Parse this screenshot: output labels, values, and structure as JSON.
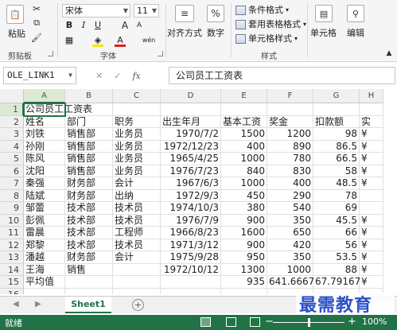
{
  "ribbon": {
    "paste_label": "粘贴",
    "clipboard_label": "剪贴板",
    "font_name": "宋体",
    "font_size": "11",
    "bold": "B",
    "italic": "I",
    "underline": "U",
    "grow_font": "A",
    "shrink_font": "A",
    "font_color_glyph": "A",
    "wen_label": "wén",
    "font_label": "字体",
    "align_label": "对齐方式",
    "number_label": "数字",
    "percent_glyph": "%",
    "cond_format_label": "条件格式",
    "table_format_label": "套用表格格式",
    "cell_style_label": "单元格样式",
    "styles_label": "样式",
    "cells_label": "单元格",
    "edit_label": "编辑"
  },
  "formula_bar": {
    "name_box": "OLE_LINK1",
    "cancel_glyph": "✕",
    "enter_glyph": "✓",
    "fx_glyph": "fx",
    "formula": "公司员工工资表"
  },
  "columns": [
    "A",
    "B",
    "C",
    "D",
    "E",
    "F",
    "G",
    "H"
  ],
  "rows": [
    {
      "n": "1",
      "c": [
        "公司员工工资表",
        "",
        "",
        "",
        "",
        "",
        "",
        ""
      ]
    },
    {
      "n": "2",
      "c": [
        "姓名",
        "部门",
        "职务",
        "出生年月",
        "基本工资",
        "奖金",
        "扣款额",
        "实"
      ]
    },
    {
      "n": "3",
      "c": [
        "刘铁",
        "销售部",
        "业务员",
        "1970/7/2",
        "1500",
        "1200",
        "98",
        "¥"
      ]
    },
    {
      "n": "4",
      "c": [
        "孙刚",
        "销售部",
        "业务员",
        "1972/12/23",
        "400",
        "890",
        "86.5",
        "¥"
      ]
    },
    {
      "n": "5",
      "c": [
        "陈风",
        "销售部",
        "业务员",
        "1965/4/25",
        "1000",
        "780",
        "66.5",
        "¥"
      ]
    },
    {
      "n": "6",
      "c": [
        "沈阳",
        "销售部",
        "业务员",
        "1976/7/23",
        "840",
        "830",
        "58",
        "¥"
      ]
    },
    {
      "n": "7",
      "c": [
        "秦强",
        "财务部",
        "会计",
        "1967/6/3",
        "1000",
        "400",
        "48.5",
        "¥"
      ]
    },
    {
      "n": "8",
      "c": [
        "陆斌",
        "财务部",
        "出纳",
        "1972/9/3",
        "450",
        "290",
        "78",
        ""
      ]
    },
    {
      "n": "9",
      "c": [
        "邹蕾",
        "技术部",
        "技术员",
        "1974/10/3",
        "380",
        "540",
        "69",
        ""
      ]
    },
    {
      "n": "10",
      "c": [
        "彭佩",
        "技术部",
        "技术员",
        "1976/7/9",
        "900",
        "350",
        "45.5",
        "¥"
      ]
    },
    {
      "n": "11",
      "c": [
        "雷晨",
        "技术部",
        "工程师",
        "1966/8/23",
        "1600",
        "650",
        "66",
        "¥"
      ]
    },
    {
      "n": "12",
      "c": [
        "郑黎",
        "技术部",
        "技术员",
        "1971/3/12",
        "900",
        "420",
        "56",
        "¥"
      ]
    },
    {
      "n": "13",
      "c": [
        "潘越",
        "财务部",
        "会计",
        "1975/9/28",
        "950",
        "350",
        "53.5",
        "¥"
      ]
    },
    {
      "n": "14",
      "c": [
        "王海",
        "销售",
        "",
        "1972/10/12",
        "1300",
        "1000",
        "88",
        "¥"
      ]
    },
    {
      "n": "15",
      "c": [
        "平均值",
        "",
        "",
        "",
        "935",
        "641.6667",
        "67.79167",
        "¥"
      ]
    },
    {
      "n": "16",
      "c": [
        "",
        "",
        "",
        "",
        "",
        "",
        "",
        ""
      ]
    }
  ],
  "tabs": {
    "prev": "◀",
    "next": "▶",
    "sheet_name": "Sheet1",
    "add": "+"
  },
  "status": {
    "text": "就绪",
    "zoom_minus": "−",
    "zoom_plus": "+",
    "zoom": "100%",
    "zoom_level_pct": 100
  },
  "watermark": "最需教育"
}
